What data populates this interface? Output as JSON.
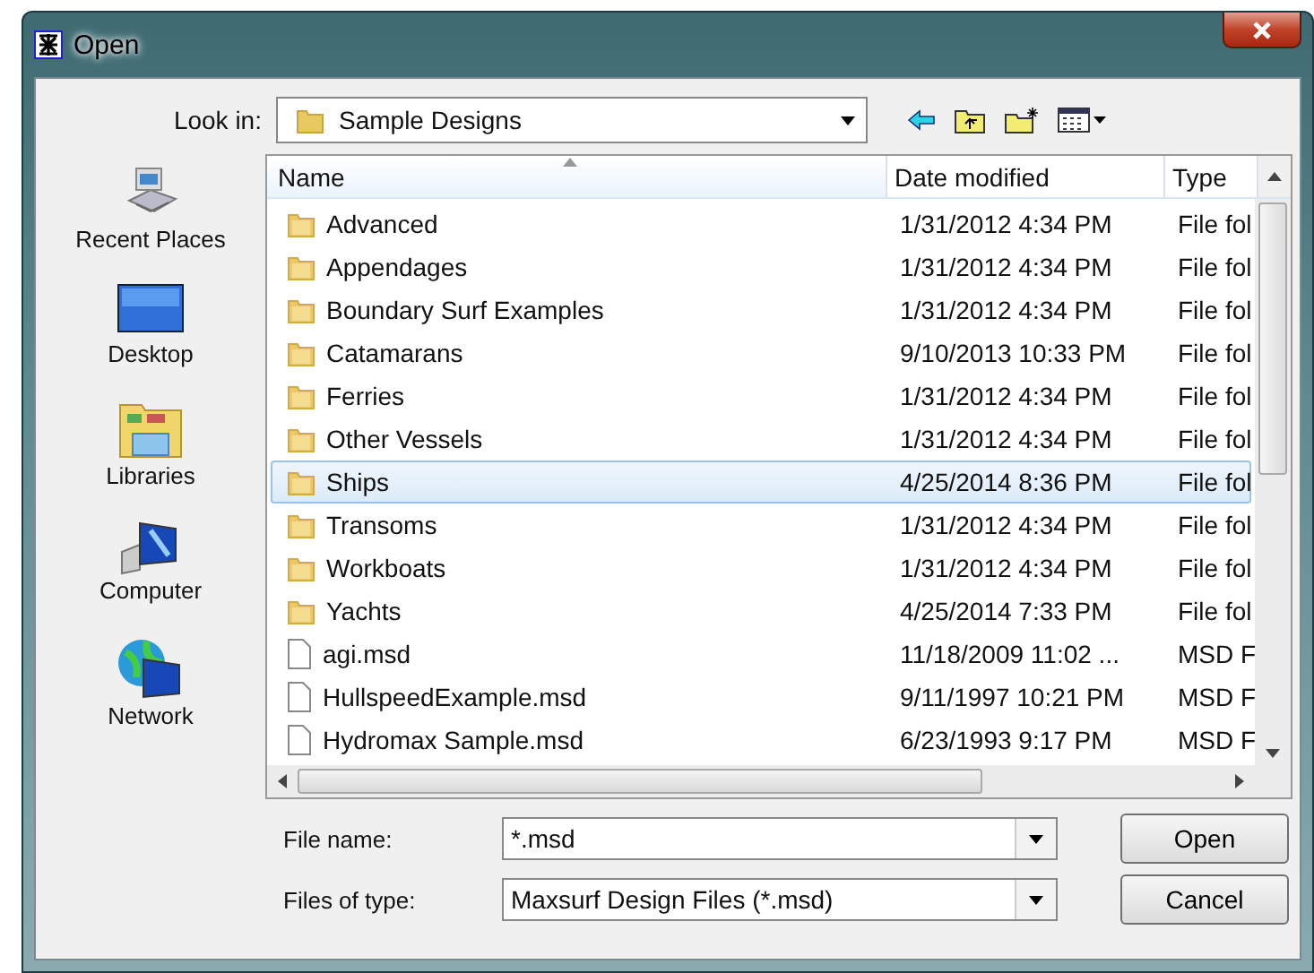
{
  "window": {
    "title": "Open"
  },
  "look_in": {
    "label": "Look in:",
    "value": "Sample Designs"
  },
  "places": [
    {
      "kind": "recent",
      "label": "Recent Places"
    },
    {
      "kind": "desktop",
      "label": "Desktop"
    },
    {
      "kind": "libraries",
      "label": "Libraries"
    },
    {
      "kind": "computer",
      "label": "Computer"
    },
    {
      "kind": "network",
      "label": "Network"
    }
  ],
  "columns": [
    "Name",
    "Date modified",
    "Type"
  ],
  "rows": [
    {
      "kind": "folder",
      "name": "Advanced",
      "date": "1/31/2012 4:34 PM",
      "type": "File fol",
      "selected": false
    },
    {
      "kind": "folder",
      "name": "Appendages",
      "date": "1/31/2012 4:34 PM",
      "type": "File fol",
      "selected": false
    },
    {
      "kind": "folder",
      "name": "Boundary Surf Examples",
      "date": "1/31/2012 4:34 PM",
      "type": "File fol",
      "selected": false
    },
    {
      "kind": "folder",
      "name": "Catamarans",
      "date": "9/10/2013 10:33 PM",
      "type": "File fol",
      "selected": false
    },
    {
      "kind": "folder",
      "name": "Ferries",
      "date": "1/31/2012 4:34 PM",
      "type": "File fol",
      "selected": false
    },
    {
      "kind": "folder",
      "name": "Other Vessels",
      "date": "1/31/2012 4:34 PM",
      "type": "File fol",
      "selected": false
    },
    {
      "kind": "folder",
      "name": "Ships",
      "date": "4/25/2014 8:36 PM",
      "type": "File fol",
      "selected": true
    },
    {
      "kind": "folder",
      "name": "Transoms",
      "date": "1/31/2012 4:34 PM",
      "type": "File fol",
      "selected": false
    },
    {
      "kind": "folder",
      "name": "Workboats",
      "date": "1/31/2012 4:34 PM",
      "type": "File fol",
      "selected": false
    },
    {
      "kind": "folder",
      "name": "Yachts",
      "date": "4/25/2014 7:33 PM",
      "type": "File fol",
      "selected": false
    },
    {
      "kind": "file",
      "name": "agi.msd",
      "date": "11/18/2009 11:02 ...",
      "type": "MSD F",
      "selected": false
    },
    {
      "kind": "file",
      "name": "HullspeedExample.msd",
      "date": "9/11/1997 10:21 PM",
      "type": "MSD F",
      "selected": false
    },
    {
      "kind": "file",
      "name": "Hydromax Sample.msd",
      "date": "6/23/1993 9:17 PM",
      "type": "MSD F",
      "selected": false
    }
  ],
  "file_name": {
    "label": "File name:",
    "value": "*.msd"
  },
  "file_type": {
    "label": "Files of type:",
    "value": "Maxsurf Design Files (*.msd)"
  },
  "buttons": [
    "Open",
    "Cancel"
  ]
}
